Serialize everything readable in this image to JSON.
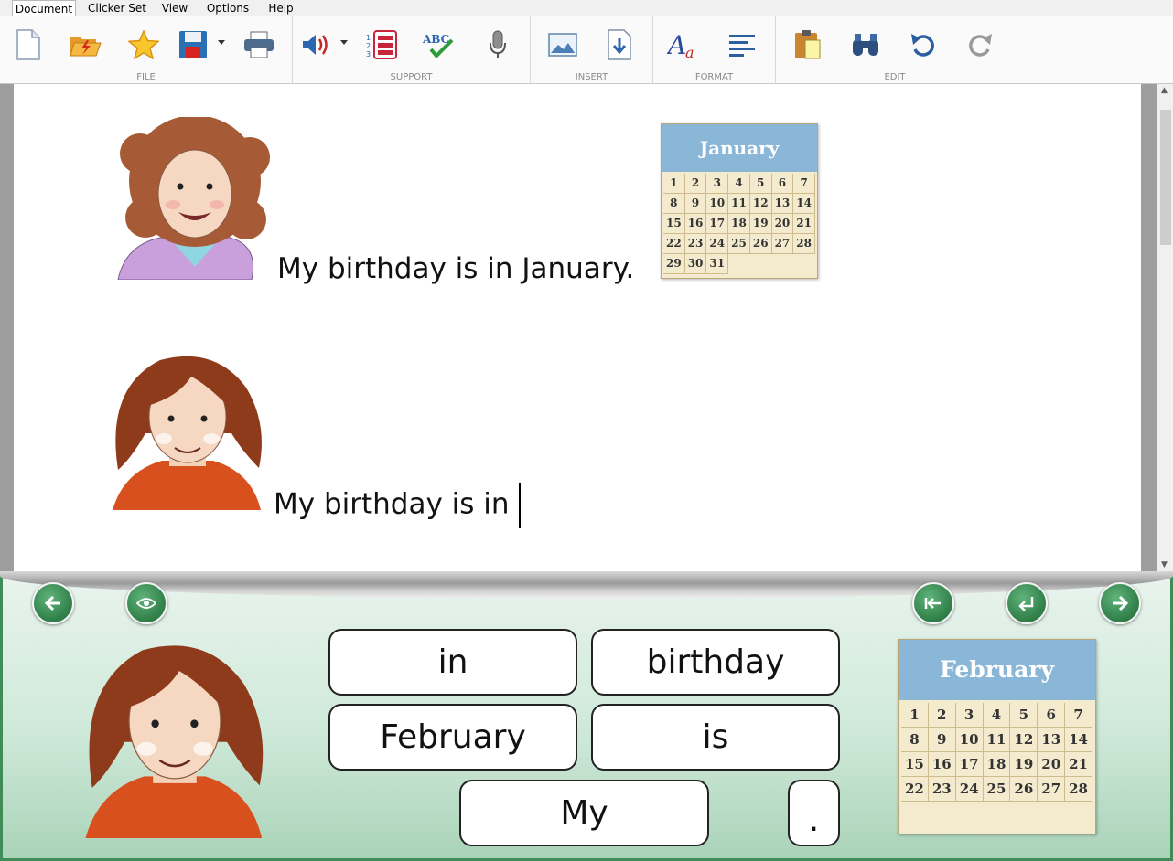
{
  "tabs": [
    "Document",
    "Clicker Set",
    "View",
    "Options",
    "Help"
  ],
  "groups": {
    "file": "FILE",
    "support": "SUPPORT",
    "insert": "INSERT",
    "format": "FORMAT",
    "edit": "EDIT"
  },
  "document": {
    "line1": "My birthday is in January.",
    "line2": "My birthday is in",
    "calendar": {
      "month": "January",
      "days": [
        "1",
        "2",
        "3",
        "4",
        "5",
        "6",
        "7",
        "8",
        "9",
        "10",
        "11",
        "12",
        "13",
        "14",
        "15",
        "16",
        "17",
        "18",
        "19",
        "20",
        "21",
        "22",
        "23",
        "24",
        "25",
        "26",
        "27",
        "28",
        "29",
        "30",
        "31"
      ]
    }
  },
  "grid": {
    "cells": {
      "in": "in",
      "birthday": "birthday",
      "february": "February",
      "is": "is",
      "my": "My",
      "period": "."
    },
    "calendar": {
      "month": "February",
      "days": [
        "1",
        "2",
        "3",
        "4",
        "5",
        "6",
        "7",
        "8",
        "9",
        "10",
        "11",
        "12",
        "13",
        "14",
        "15",
        "16",
        "17",
        "18",
        "19",
        "20",
        "21",
        "22",
        "23",
        "24",
        "25",
        "26",
        "27",
        "28"
      ]
    }
  },
  "colors": {
    "accent": "#3f8c56",
    "calendar_header": "#8ab6d8",
    "calendar_paper": "#f4ebcf"
  }
}
